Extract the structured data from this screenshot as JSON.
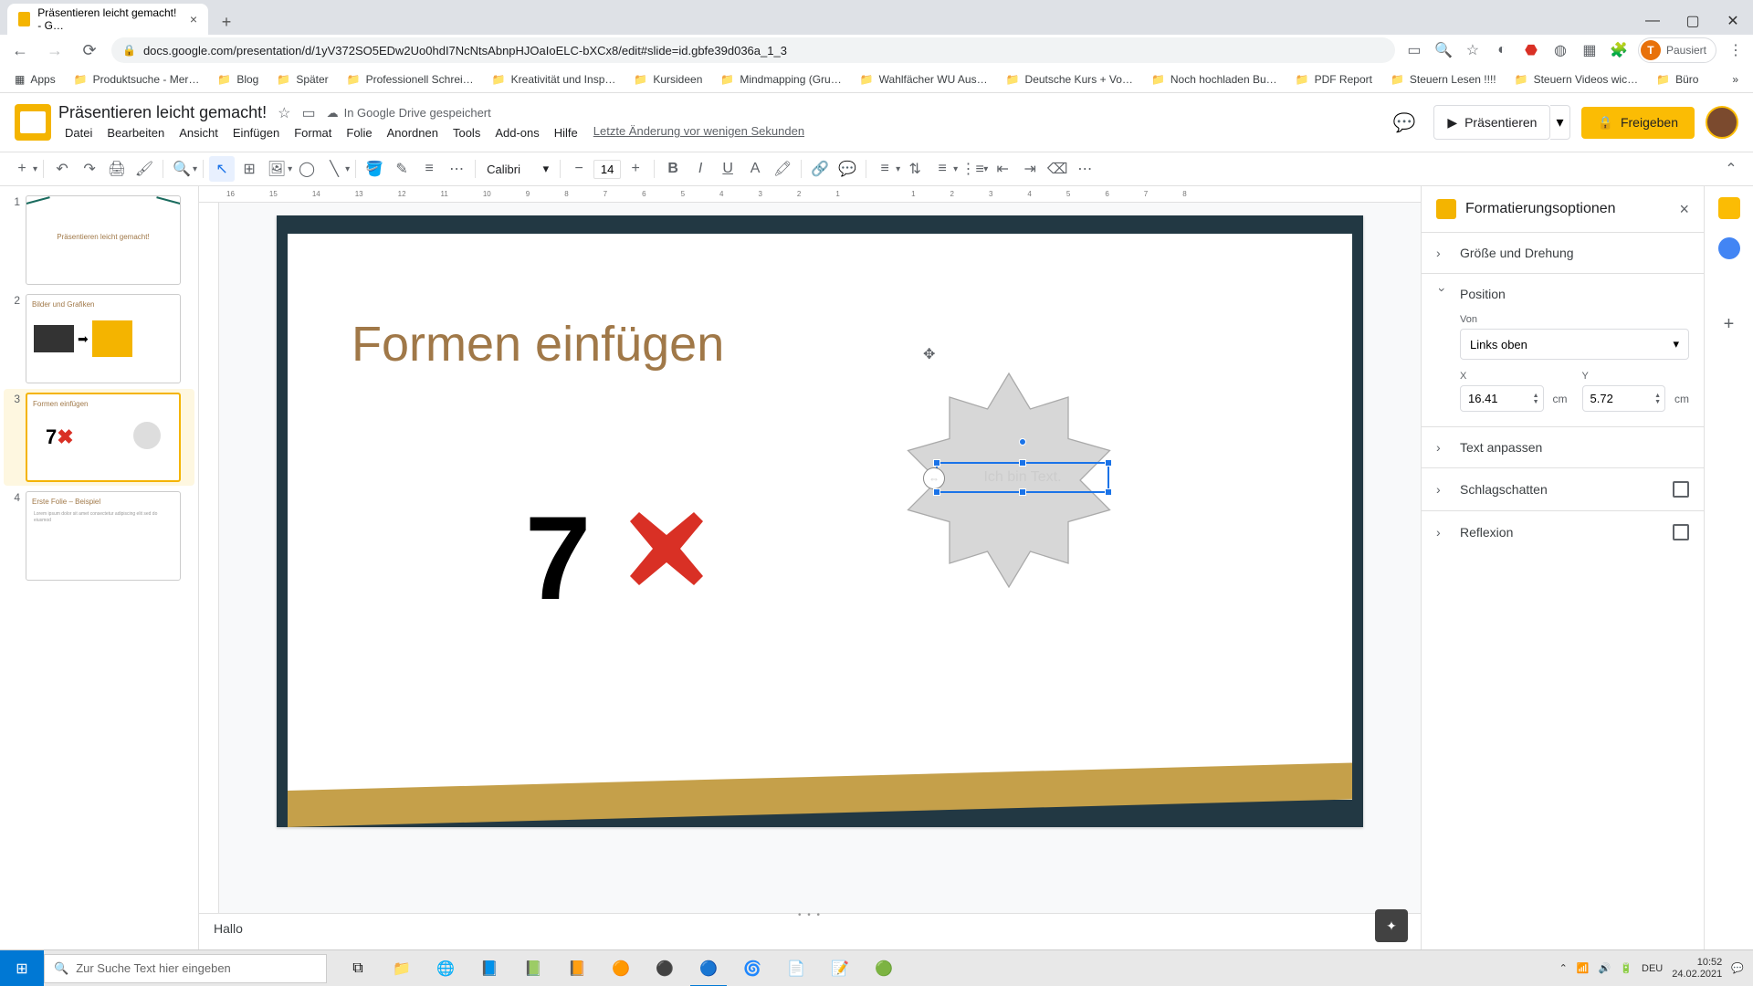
{
  "browser": {
    "tab_title": "Präsentieren leicht gemacht! - G…",
    "url": "docs.google.com/presentation/d/1yV372SO5EDw2Uo0hdI7NcNtsAbnpHJOaIoELC-bXCx8/edit#slide=id.gbfe39d036a_1_3",
    "profile_label": "Pausiert",
    "profile_initial": "T"
  },
  "bookmarks": [
    "Apps",
    "Produktsuche - Mer…",
    "Blog",
    "Später",
    "Professionell Schrei…",
    "Kreativität und Insp…",
    "Kursideen",
    "Mindmapping  (Gru…",
    "Wahlfächer WU Aus…",
    "Deutsche Kurs + Vo…",
    "Noch hochladen Bu…",
    "PDF Report",
    "Steuern Lesen !!!!",
    "Steuern Videos wic…",
    "Büro"
  ],
  "doc": {
    "title": "Präsentieren leicht gemacht!",
    "drive_status": "In Google Drive gespeichert",
    "menus": [
      "Datei",
      "Bearbeiten",
      "Ansicht",
      "Einfügen",
      "Format",
      "Folie",
      "Anordnen",
      "Tools",
      "Add-ons",
      "Hilfe"
    ],
    "last_edit": "Letzte Änderung vor wenigen Sekunden",
    "present": "Präsentieren",
    "share": "Freigeben"
  },
  "toolbar": {
    "font": "Calibri",
    "font_size": "14"
  },
  "slide": {
    "title": "Formen einfügen",
    "seven": "7",
    "textbox": "Ich bin Text."
  },
  "panel": {
    "title": "Formatierungsoptionen",
    "size": "Größe und Drehung",
    "position": "Position",
    "from_label": "Von",
    "from_value": "Links oben",
    "x_label": "X",
    "x_value": "16.41",
    "y_label": "Y",
    "y_value": "5.72",
    "unit": "cm",
    "textfit": "Text anpassen",
    "shadow": "Schlagschatten",
    "reflection": "Reflexion"
  },
  "thumbs": [
    {
      "title": "Präsentieren leicht gemacht!"
    },
    {
      "title": "Bilder und Grafiken"
    },
    {
      "title": "Formen einfügen"
    },
    {
      "title": "Erste Folie – Beispiel"
    }
  ],
  "notes": "Hallo",
  "taskbar": {
    "search_placeholder": "Zur Suche Text hier eingeben",
    "lang": "DEU",
    "time": "10:52",
    "date": "24.02.2021"
  }
}
